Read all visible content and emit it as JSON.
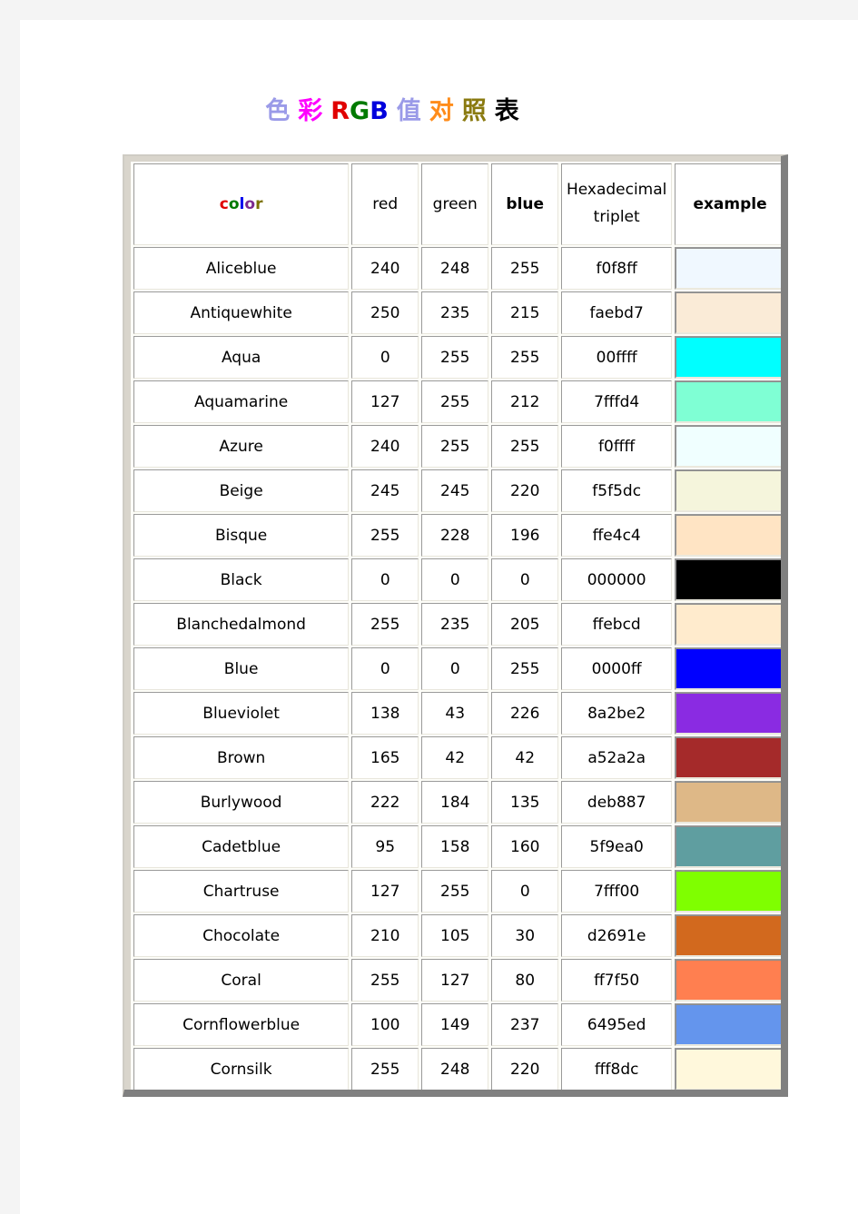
{
  "title": {
    "chars": [
      {
        "text": "色",
        "color": "#9a9ae8"
      },
      {
        "text": "彩",
        "color": "#ff00ff"
      },
      {
        "text": "R",
        "color": "#e00000"
      },
      {
        "text": "G",
        "color": "#007a00"
      },
      {
        "text": "B",
        "color": "#0000dd"
      },
      {
        "text": "值",
        "color": "#9a9ae8"
      },
      {
        "text": "对",
        "color": "#ff8c1a"
      },
      {
        "text": "照",
        "color": "#8a7a10"
      },
      {
        "text": "表",
        "color": "#000000"
      }
    ],
    "plain": "色彩 RGB 值对照表"
  },
  "table": {
    "headers": {
      "color": "color",
      "color_letters": [
        "c",
        "o",
        "l",
        "o",
        "r"
      ],
      "red": "red",
      "green": "green",
      "blue": "blue",
      "hex_line1": "Hexadecimal",
      "hex_line2": "triplet",
      "example": "example"
    },
    "rows": [
      {
        "name": "Aliceblue",
        "red": "240",
        "green": "248",
        "blue": "255",
        "hex": "f0f8ff",
        "swatch": "#f0f8ff"
      },
      {
        "name": "Antiquewhite",
        "red": "250",
        "green": "235",
        "blue": "215",
        "hex": "faebd7",
        "swatch": "#faebd7"
      },
      {
        "name": "Aqua",
        "red": "0",
        "green": "255",
        "blue": "255",
        "hex": "00ffff",
        "swatch": "#00ffff"
      },
      {
        "name": "Aquamarine",
        "red": "127",
        "green": "255",
        "blue": "212",
        "hex": "7fffd4",
        "swatch": "#7fffd4"
      },
      {
        "name": "Azure",
        "red": "240",
        "green": "255",
        "blue": "255",
        "hex": "f0ffff",
        "swatch": "#f0ffff"
      },
      {
        "name": "Beige",
        "red": "245",
        "green": "245",
        "blue": "220",
        "hex": "f5f5dc",
        "swatch": "#f5f5dc"
      },
      {
        "name": "Bisque",
        "red": "255",
        "green": "228",
        "blue": "196",
        "hex": "ffe4c4",
        "swatch": "#ffe4c4"
      },
      {
        "name": "Black",
        "red": "0",
        "green": "0",
        "blue": "0",
        "hex": "000000",
        "swatch": "#000000"
      },
      {
        "name": "Blanchedalmond",
        "red": "255",
        "green": "235",
        "blue": "205",
        "hex": "ffebcd",
        "swatch": "#ffebcd"
      },
      {
        "name": "Blue",
        "red": "0",
        "green": "0",
        "blue": "255",
        "hex": "0000ff",
        "swatch": "#0000ff"
      },
      {
        "name": "Blueviolet",
        "red": "138",
        "green": "43",
        "blue": "226",
        "hex": "8a2be2",
        "swatch": "#8a2be2"
      },
      {
        "name": "Brown",
        "red": "165",
        "green": "42",
        "blue": "42",
        "hex": "a52a2a",
        "swatch": "#a52a2a"
      },
      {
        "name": "Burlywood",
        "red": "222",
        "green": "184",
        "blue": "135",
        "hex": "deb887",
        "swatch": "#deb887"
      },
      {
        "name": "Cadetblue",
        "red": "95",
        "green": "158",
        "blue": "160",
        "hex": "5f9ea0",
        "swatch": "#5f9ea0"
      },
      {
        "name": "Chartruse",
        "red": "127",
        "green": "255",
        "blue": "0",
        "hex": "7fff00",
        "swatch": "#7fff00"
      },
      {
        "name": "Chocolate",
        "red": "210",
        "green": "105",
        "blue": "30",
        "hex": "d2691e",
        "swatch": "#d2691e"
      },
      {
        "name": "Coral",
        "red": "255",
        "green": "127",
        "blue": "80",
        "hex": "ff7f50",
        "swatch": "#ff7f50"
      },
      {
        "name": "Cornflowerblue",
        "red": "100",
        "green": "149",
        "blue": "237",
        "hex": "6495ed",
        "swatch": "#6495ed"
      },
      {
        "name": "Cornsilk",
        "red": "255",
        "green": "248",
        "blue": "220",
        "hex": "fff8dc",
        "swatch": "#fff8dc"
      }
    ]
  },
  "theme": {
    "page_background": "#f4f4f4",
    "sheet_background": "#ffffff",
    "frame_fill": "#d9d5cc",
    "frame_shadow": "#808080",
    "cell_border_dark": "#9a9a9a",
    "cell_border_light": "#e8e6dc",
    "text_red": "#e00000",
    "text_green": "#1d6b1d",
    "text_blue": "#1414e0"
  }
}
